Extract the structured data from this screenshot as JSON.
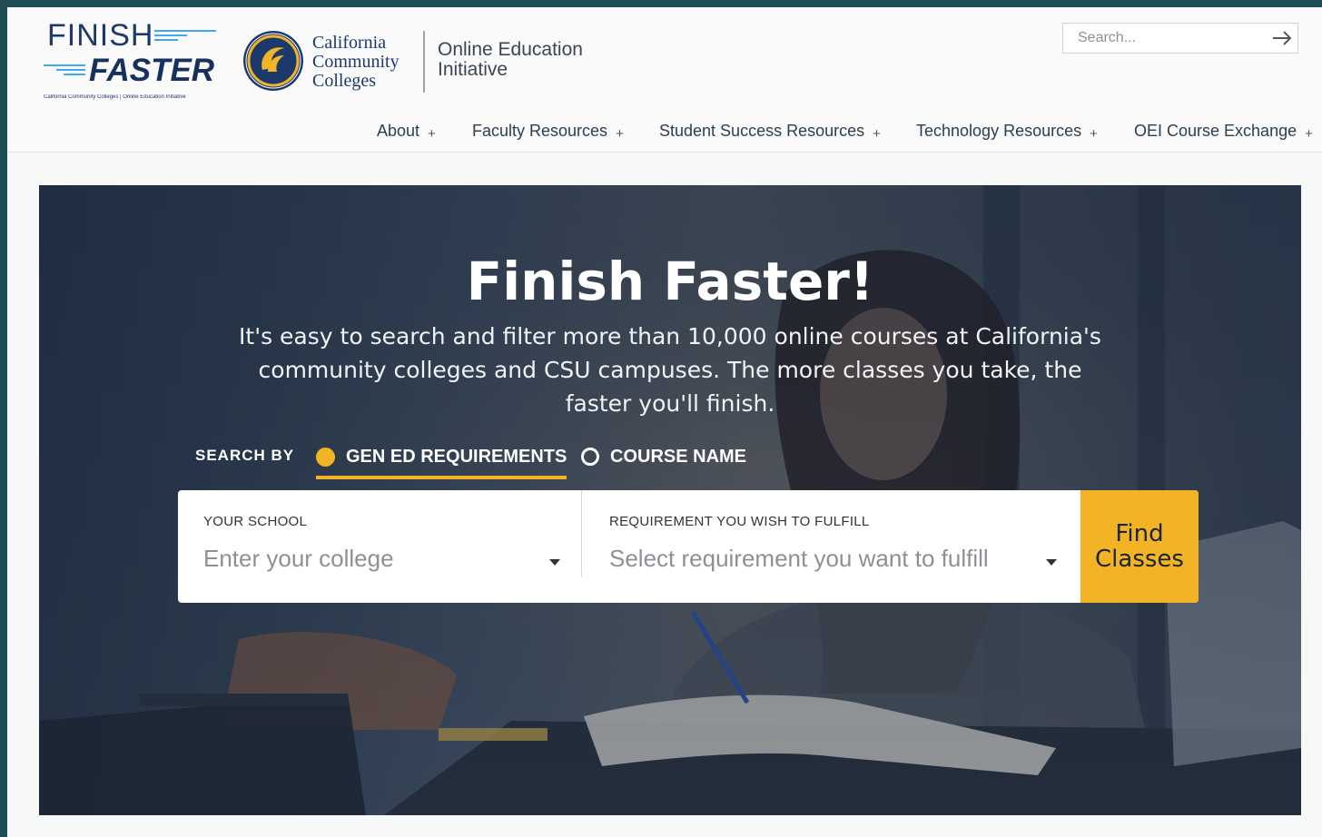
{
  "branding": {
    "finish_faster_top": "FINISH",
    "finish_faster_bottom": "FASTER",
    "finish_faster_tagline": "California Community Colleges | Online Education Initiative",
    "ccc_lines": [
      "California",
      "Community",
      "Colleges"
    ],
    "oei_lines": [
      "Online Education",
      "Initiative"
    ]
  },
  "search": {
    "placeholder": "Search..."
  },
  "nav": {
    "items": [
      {
        "label": "About"
      },
      {
        "label": "Faculty Resources"
      },
      {
        "label": "Student Success Resources"
      },
      {
        "label": "Technology Resources"
      },
      {
        "label": "OEI Course Exchange"
      }
    ],
    "expand_symbol": "+"
  },
  "hero": {
    "title": "Finish Faster!",
    "subtitle": "It's easy to search and filter more than 10,000 online courses at California's community colleges and CSU campuses. The more classes you take, the faster you'll finish.",
    "search_by_label": "SEARCH BY",
    "options": [
      {
        "label": "GEN ED REQUIREMENTS",
        "selected": true
      },
      {
        "label": "COURSE NAME",
        "selected": false
      }
    ]
  },
  "form": {
    "school_label": "YOUR SCHOOL",
    "school_placeholder": "Enter your college",
    "requirement_label": "REQUIREMENT YOU WISH TO FULFILL",
    "requirement_placeholder": "Select requirement you want to fulfill",
    "submit_label": "Find Classes"
  },
  "colors": {
    "accent": "#f2b326",
    "navy": "#1b3a6b",
    "frame": "#1f4e57"
  }
}
